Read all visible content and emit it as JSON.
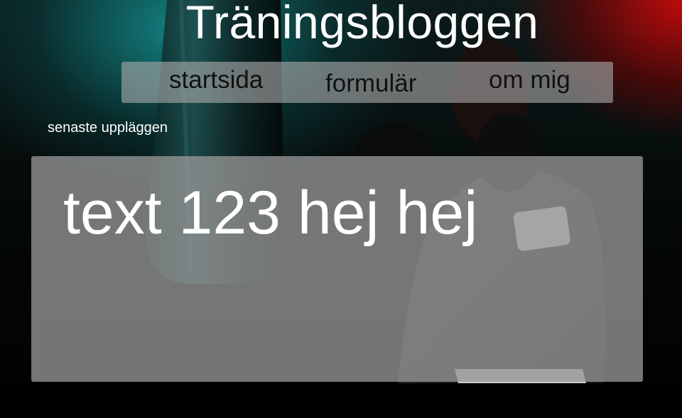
{
  "header": {
    "site_title": "Träningsbloggen"
  },
  "nav": {
    "items": [
      {
        "label": "startsida"
      },
      {
        "label": "formulär"
      },
      {
        "label": "om mig"
      }
    ]
  },
  "main": {
    "section_label": "senaste uppläggen",
    "posts": [
      {
        "text": "text 123 hej hej"
      }
    ]
  },
  "theme": {
    "background": "#000000",
    "accent_red": "#c80a0a",
    "accent_teal": "#149696",
    "panel": "#969696",
    "text": "#ffffff",
    "nav_text": "#111111"
  },
  "images": {
    "hero": "boxer-with-punching-bag-photo"
  }
}
